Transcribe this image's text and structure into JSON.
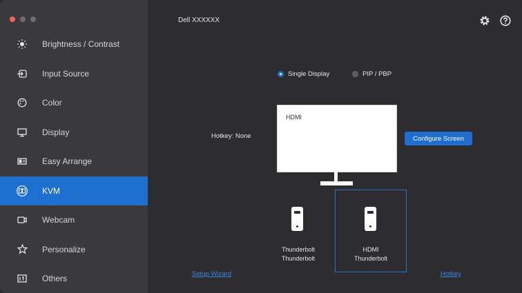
{
  "window": {
    "title": "Dell XXXXXX"
  },
  "colors": {
    "accent": "#1d6fd0",
    "traffic_close": "#ff5f57",
    "traffic_min": "#6e6e70",
    "traffic_max": "#6e6e70"
  },
  "sidebar": {
    "items": [
      {
        "label": "Brightness / Contrast",
        "icon": "sun-icon"
      },
      {
        "label": "Input Source",
        "icon": "input-source-icon"
      },
      {
        "label": "Color",
        "icon": "color-palette-icon"
      },
      {
        "label": "Display",
        "icon": "monitor-icon"
      },
      {
        "label": "Easy Arrange",
        "icon": "layout-icon"
      },
      {
        "label": "KVM",
        "icon": "kvm-icon",
        "active": true
      },
      {
        "label": "Webcam",
        "icon": "webcam-icon"
      },
      {
        "label": "Personalize",
        "icon": "star-icon"
      },
      {
        "label": "Others",
        "icon": "others-icon"
      }
    ]
  },
  "header": {
    "settings_icon": "gear-icon",
    "help_icon": "help-icon"
  },
  "main": {
    "mode_options": [
      {
        "label": "Single Display",
        "selected": true
      },
      {
        "label": "PIP / PBP",
        "selected": false
      }
    ],
    "hotkey_label": "Hotkey: None",
    "monitor_input": "HDMI",
    "configure_button": "Configure Screen",
    "computers": [
      {
        "line1": "Thunderbolt",
        "line2": "Thunderbolt",
        "selected": false
      },
      {
        "line1": "HDMI",
        "line2": "Thunderbolt",
        "selected": true
      }
    ],
    "setup_wizard_link": "Setup Wizard",
    "hotkey_link": "Hotkey"
  }
}
